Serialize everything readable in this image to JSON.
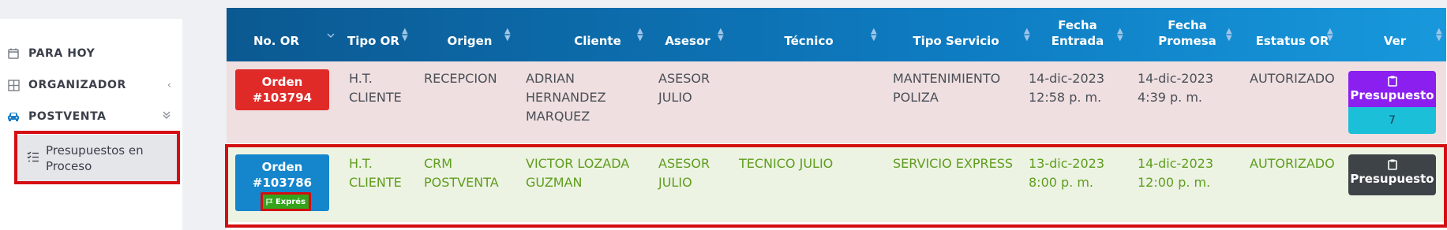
{
  "sidebar": {
    "items": [
      {
        "label": "PARA HOY",
        "icon": "calendar-icon"
      },
      {
        "label": "ORGANIZADOR",
        "icon": "grid-icon",
        "chevron": "‹"
      },
      {
        "label": "POSTVENTA",
        "icon": "car-icon",
        "chevron": "»"
      }
    ],
    "submenu": {
      "label": "Presupuestos en Proceso",
      "icon": "task-list-icon"
    }
  },
  "table": {
    "columns": [
      {
        "label": "No. OR"
      },
      {
        "label": "Tipo OR"
      },
      {
        "label": "Origen"
      },
      {
        "label": "Cliente"
      },
      {
        "label": "Asesor"
      },
      {
        "label": "Técnico"
      },
      {
        "label": "Tipo Servicio"
      },
      {
        "label": "Fecha Entrada",
        "line1": "Fecha",
        "line2": "Entrada"
      },
      {
        "label": "Fecha Promesa",
        "line1": "Fecha",
        "line2": "Promesa"
      },
      {
        "label": "Estatus OR"
      },
      {
        "label": "Ver"
      }
    ],
    "rows": [
      {
        "order_l1": "Orden",
        "order_l2": "#103794",
        "tipo_l1": "H.T.",
        "tipo_l2": "CLIENTE",
        "origen_l1": "RECEPCION",
        "origen_l2": "",
        "cliente_l1": "ADRIAN",
        "cliente_l2": "HERNANDEZ",
        "cliente_l3": "MARQUEZ",
        "asesor_l1": "ASESOR",
        "asesor_l2": "JULIO",
        "tecnico": "",
        "servicio_l1": "MANTENIMIENTO",
        "servicio_l2": "POLIZA",
        "entrada_l1": "14-dic-2023",
        "entrada_l2": "12:58 p. m.",
        "promesa_l1": "14-dic-2023",
        "promesa_l2": "4:39 p. m.",
        "estatus": "AUTORIZADO",
        "ver_label": "Presupuesto",
        "ver_count": "7",
        "colors": {
          "order_bg": "#e02a28",
          "ver_bg": "#8a1ff0",
          "row_bg": "#efdfe0"
        }
      },
      {
        "order_l1": "Orden",
        "order_l2": "#103786",
        "badge": "Exprés",
        "tipo_l1": "H.T.",
        "tipo_l2": "CLIENTE",
        "origen_l1": "CRM",
        "origen_l2": "POSTVENTA",
        "cliente_l1": "VICTOR LOZADA",
        "cliente_l2": "GUZMAN",
        "cliente_l3": "",
        "asesor_l1": "ASESOR",
        "asesor_l2": "JULIO",
        "tecnico": "TECNICO JULIO",
        "servicio_l1": "SERVICIO EXPRESS",
        "servicio_l2": "",
        "entrada_l1": "13-dic-2023",
        "entrada_l2": "8:00 p. m.",
        "promesa_l1": "14-dic-2023",
        "promesa_l2": "12:00 p. m.",
        "estatus": "AUTORIZADO",
        "ver_label": "Presupuesto",
        "colors": {
          "order_bg": "#1586cc",
          "ver_bg": "#3e4348",
          "row_bg": "#ecf3e2",
          "text": "#5f9d1e"
        }
      }
    ]
  },
  "colors": {
    "header": "#0e7cc2",
    "highlight": "#d40d12",
    "badge": "#34a41b"
  }
}
